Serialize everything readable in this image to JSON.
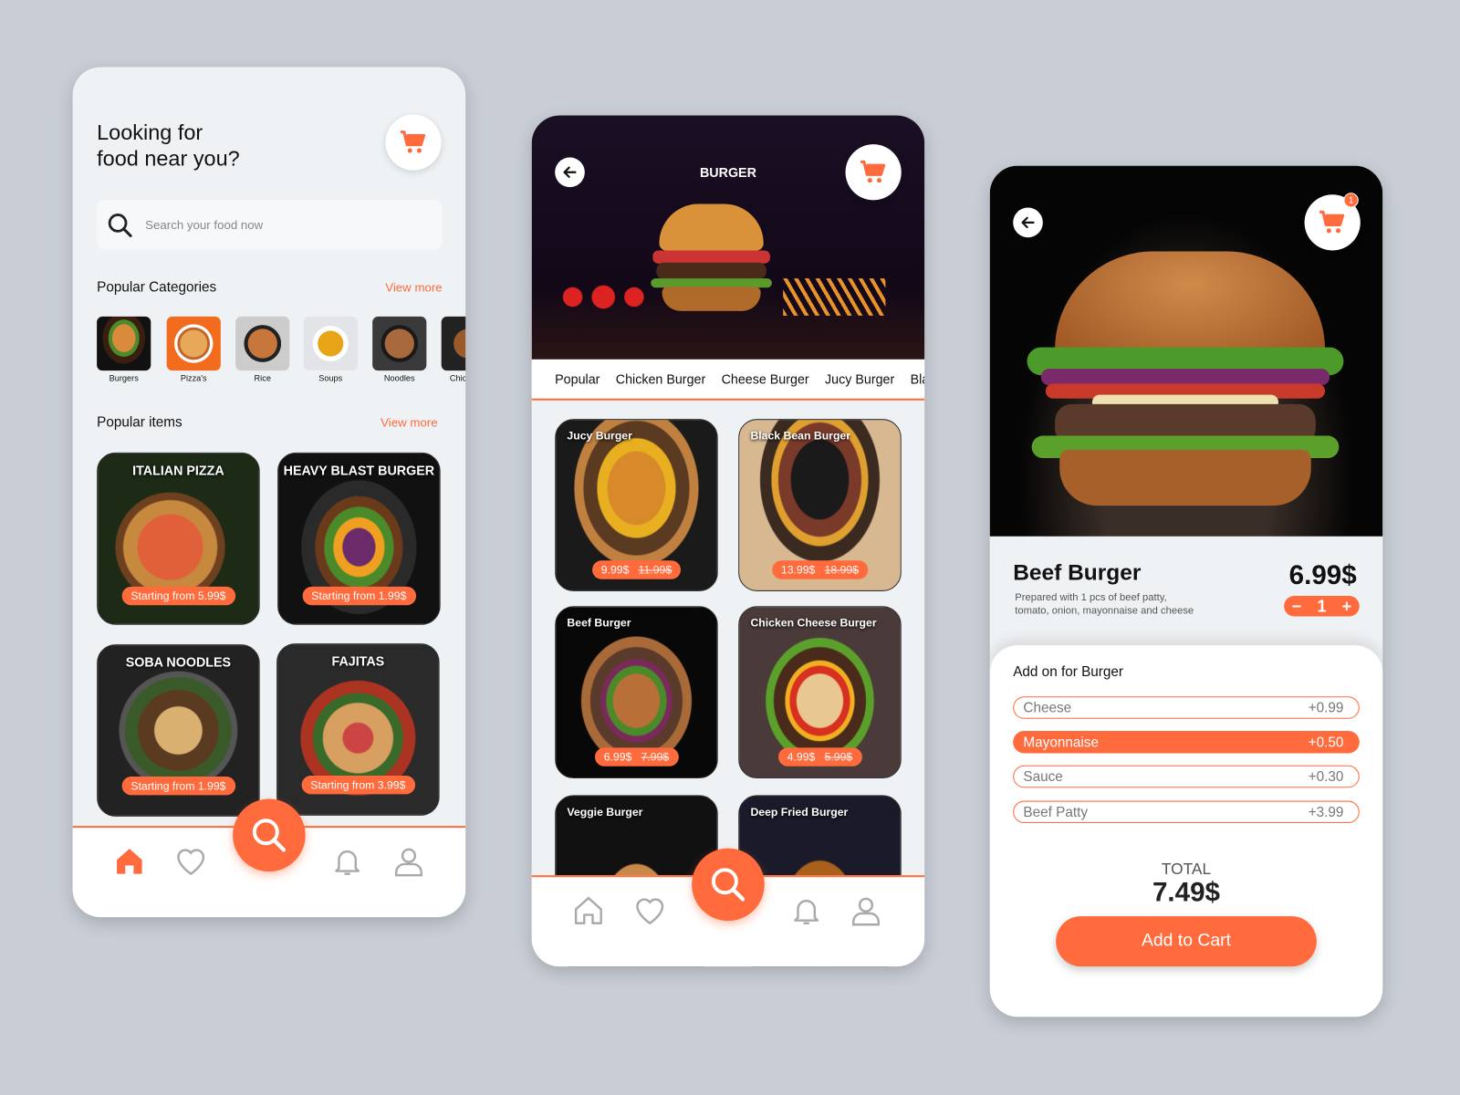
{
  "colors": {
    "accent": "#ff6b3d",
    "background": "#c9ced6"
  },
  "home": {
    "title_line1": "Looking for",
    "title_line2": "food near you?",
    "cart_icon": "cart-icon",
    "search": {
      "placeholder": "Search your food now"
    },
    "categories_heading": "Popular Categories",
    "categories_view_more": "View more",
    "categories": [
      {
        "label": "Burgers"
      },
      {
        "label": "Pizza's"
      },
      {
        "label": "Rice"
      },
      {
        "label": "Soups"
      },
      {
        "label": "Noodles"
      },
      {
        "label": "Chic"
      }
    ],
    "items_heading": "Popular items",
    "items_view_more": "View more",
    "items": [
      {
        "title": "ITALIAN PIZZA",
        "price": "Starting from  5.99$"
      },
      {
        "title": "HEAVY BLAST BURGER",
        "price": "Starting from  1.99$"
      },
      {
        "title": "SOBA NOODLES",
        "price": "Starting from  1.99$"
      },
      {
        "title": "FAJITAS",
        "price": "Starting from  3.99$"
      }
    ],
    "nav": [
      "home-icon",
      "heart-icon",
      "search-icon",
      "bell-icon",
      "user-icon"
    ]
  },
  "listing": {
    "title": "BURGER",
    "tabs": [
      {
        "label": "Popular",
        "active": true
      },
      {
        "label": "Chicken Burger"
      },
      {
        "label": "Cheese Burger"
      },
      {
        "label": "Jucy Burger"
      },
      {
        "label": "Blac"
      }
    ],
    "products": [
      {
        "name": "Jucy Burger",
        "price": "9.99$",
        "old_price": "11.99$"
      },
      {
        "name": "Black Bean Burger",
        "price": "13.99$",
        "old_price": "18.99$"
      },
      {
        "name": "Beef Burger",
        "price": "6.99$",
        "old_price": "7.99$"
      },
      {
        "name": "Chicken Cheese Burger",
        "price": "4.99$",
        "old_price": "5.99$"
      },
      {
        "name": "Veggie Burger"
      },
      {
        "name": "Deep Fried Burger"
      }
    ]
  },
  "detail": {
    "cart_badge": "1",
    "name": "Beef Burger",
    "description_line1": "Prepared with 1 pcs of beef patty,",
    "description_line2": "tomato, onion, mayonnaise and cheese",
    "price": "6.99$",
    "quantity": "1",
    "minus": "−",
    "plus": "+",
    "addons_heading": "Add on for Burger",
    "addons": [
      {
        "name": "Cheese",
        "price": "+0.99",
        "selected": false
      },
      {
        "name": "Mayonnaise",
        "price": "+0.50",
        "selected": true
      },
      {
        "name": "Sauce",
        "price": "+0.30",
        "selected": false
      },
      {
        "name": "Beef Patty",
        "price": "+3.99",
        "selected": false
      }
    ],
    "total_label": "TOTAL",
    "total": "7.49$",
    "add_to_cart": "Add to Cart"
  }
}
